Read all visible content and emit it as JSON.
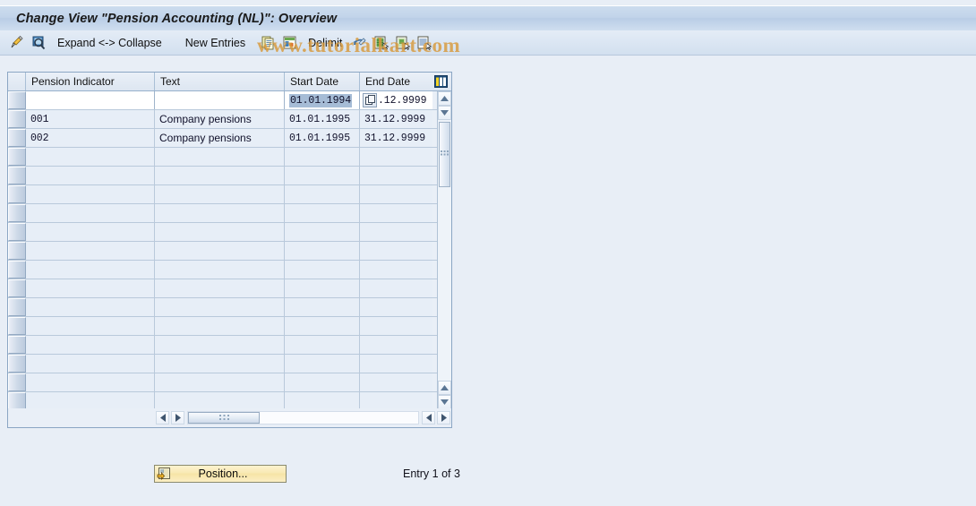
{
  "window": {
    "title": "Change View \"Pension Accounting (NL)\": Overview"
  },
  "watermark": {
    "text": "www.tutorialkart.com",
    "color": "#d89a3c"
  },
  "toolbar": {
    "items": [
      {
        "name": "display-change-icon",
        "icon": "pencil-icon",
        "label": ""
      },
      {
        "name": "display-detail-icon",
        "icon": "magnifier-icon",
        "label": ""
      },
      {
        "name": "expand-collapse-button",
        "icon": "",
        "label": "Expand <-> Collapse"
      },
      {
        "name": "new-entries-button",
        "icon": "",
        "label": "New Entries"
      },
      {
        "name": "copy-as-icon",
        "icon": "copy-icon",
        "label": ""
      },
      {
        "name": "variants-icon",
        "icon": "table-chart-icon",
        "label": ""
      },
      {
        "name": "delimit-button",
        "icon": "",
        "label": "Delimit"
      },
      {
        "name": "undo-icon",
        "icon": "undo-arrow-icon",
        "label": ""
      },
      {
        "name": "select-all-icon",
        "icon": "select-all-icon",
        "label": ""
      },
      {
        "name": "deselect-all-icon",
        "icon": "deselect-all-icon",
        "label": ""
      },
      {
        "name": "select-block-icon",
        "icon": "list-select-icon",
        "label": ""
      }
    ]
  },
  "grid": {
    "columns": [
      {
        "key": "indicator",
        "label": "Pension Indicator"
      },
      {
        "key": "text",
        "label": "Text"
      },
      {
        "key": "start_date",
        "label": "Start Date"
      },
      {
        "key": "end_date",
        "label": "End Date"
      }
    ],
    "config_icon": "table-settings-icon",
    "edit_row": {
      "indicator": "",
      "text": "",
      "start_date": "01.01.1994",
      "start_date_selected": true,
      "end_date": ".12.9999",
      "end_date_has_picker": true
    },
    "rows": [
      {
        "indicator": "001",
        "text": "Company pensions",
        "start_date": "01.01.1995",
        "end_date": "31.12.9999"
      },
      {
        "indicator": "002",
        "text": "Company pensions",
        "start_date": "01.01.1995",
        "end_date": "31.12.9999"
      }
    ],
    "empty_row_count": 15
  },
  "footer": {
    "position_button_label": "Position...",
    "position_button_icon": "position-icon",
    "entry_status": "Entry 1 of 3"
  },
  "colors": {
    "title_bar": "#c2d4ea",
    "page_background": "#e8eef6",
    "grid_border": "#8ba6c4",
    "row_background": "#e7eef7",
    "selection_highlight": "#a6bcd6",
    "button_yellow": "#f8e9b4"
  }
}
